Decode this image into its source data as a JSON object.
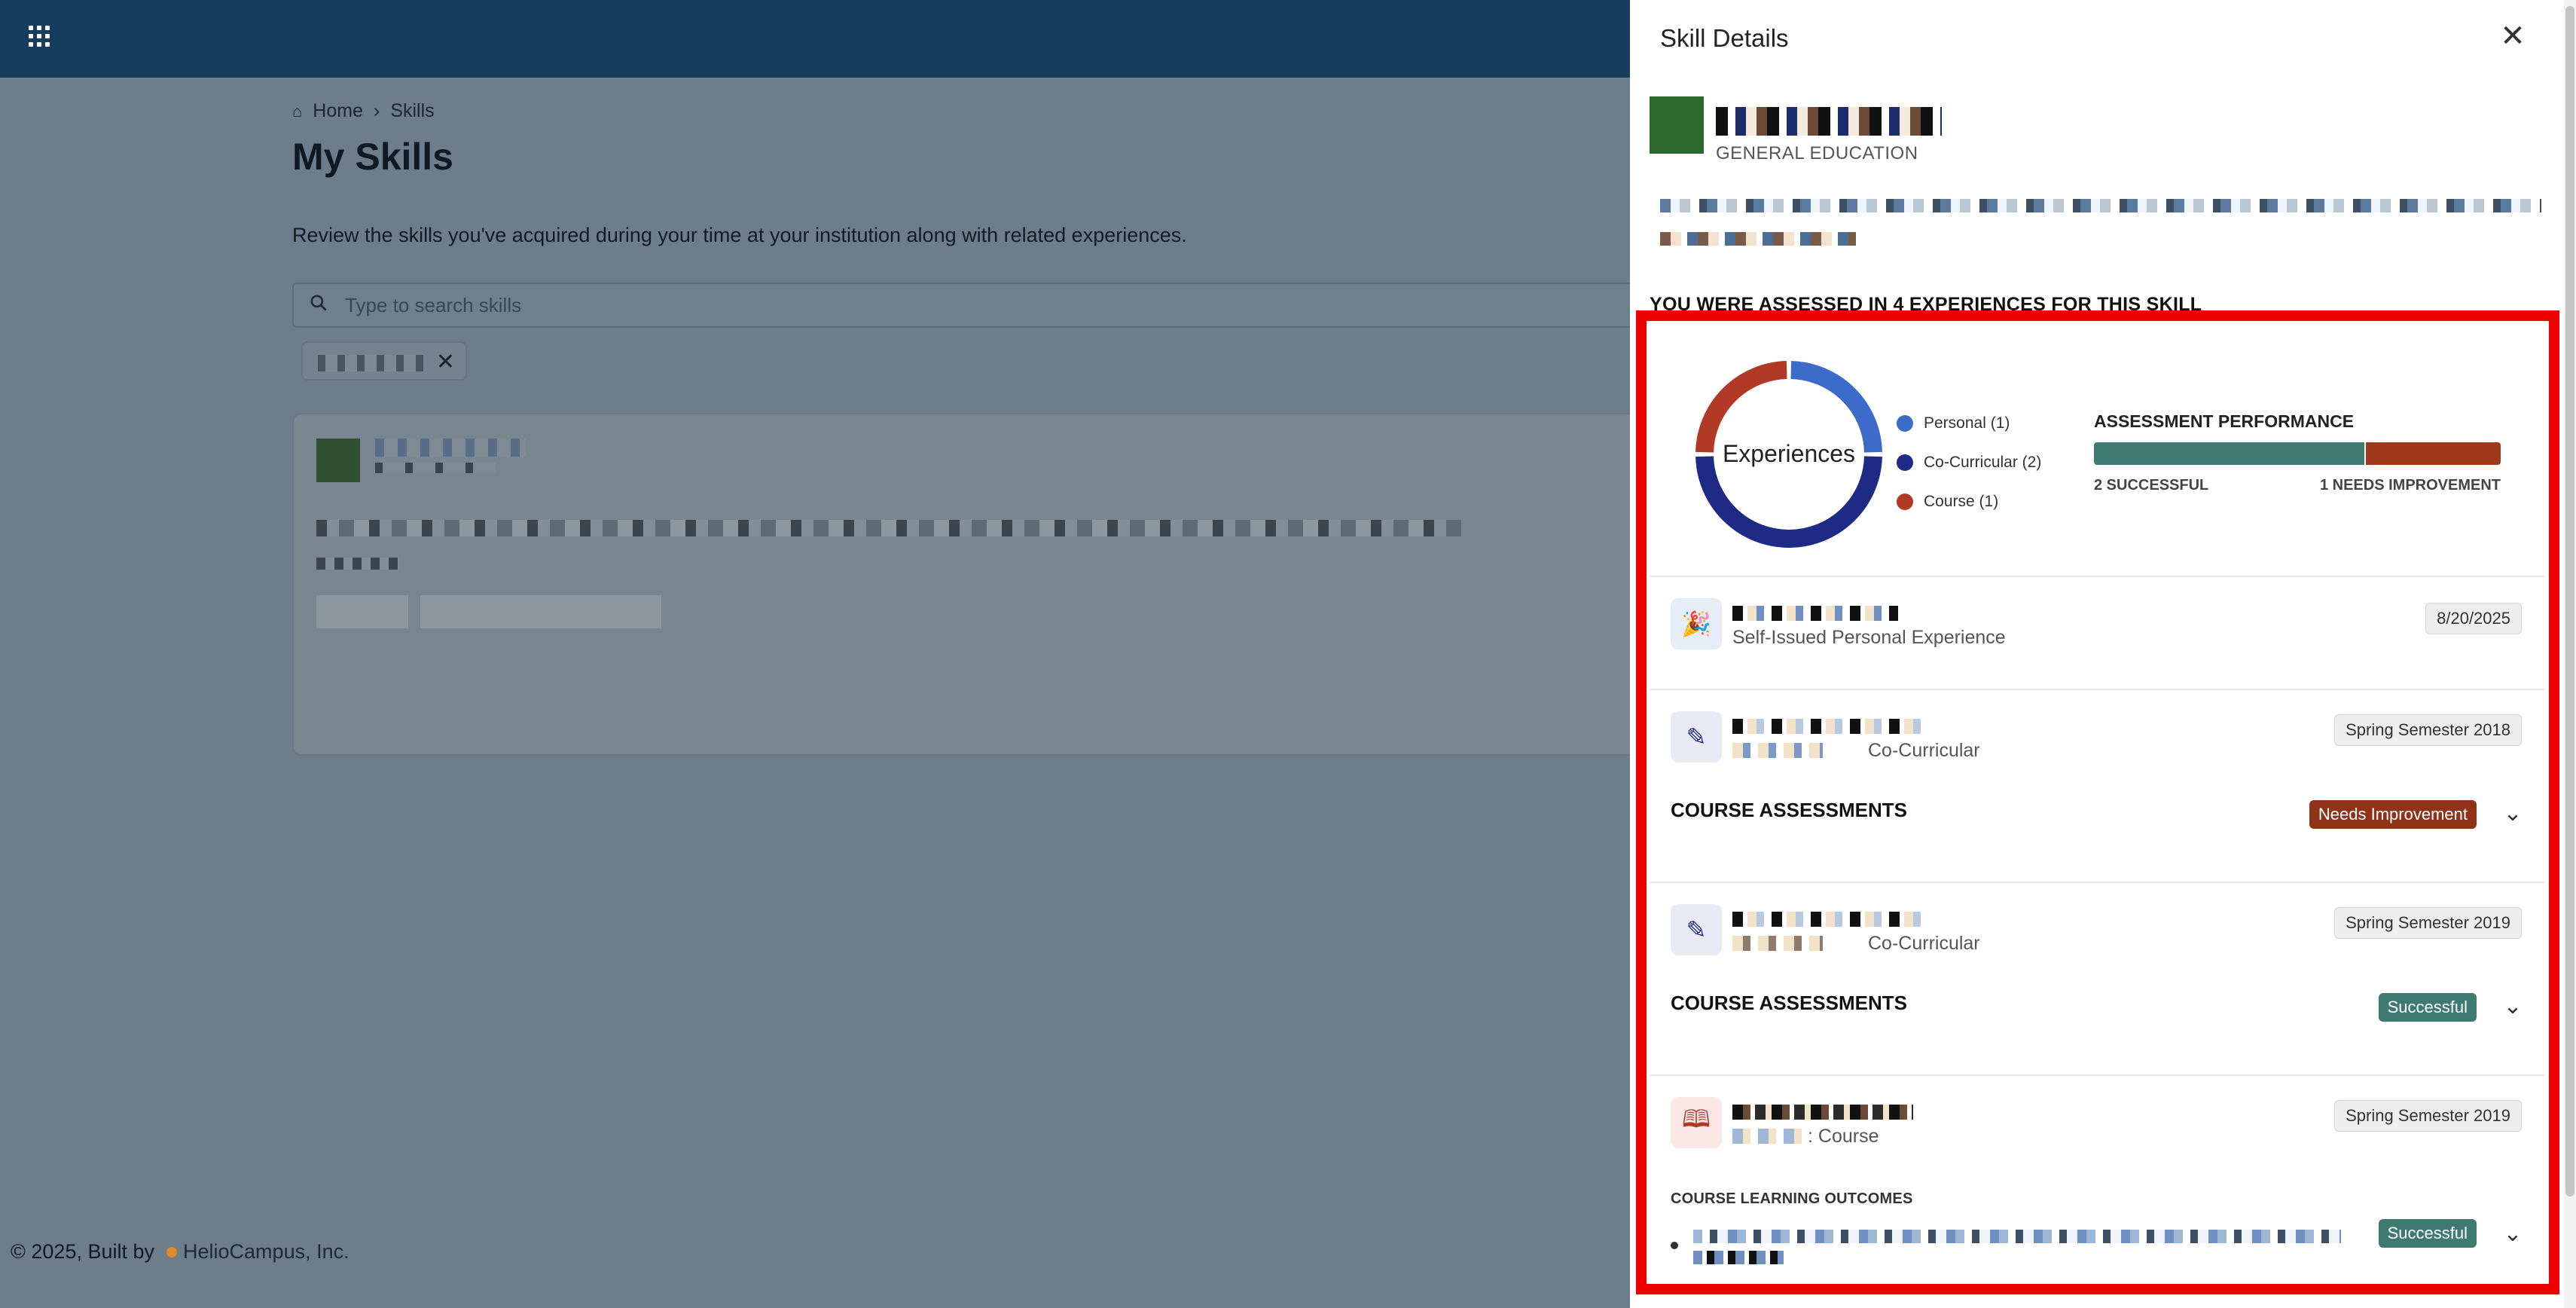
{
  "topbar": {
    "apps_icon": "grid-icon"
  },
  "breadcrumb": {
    "home": "Home",
    "separator": "›",
    "current": "Skills"
  },
  "page": {
    "title": "My Skills",
    "description": "Review the skills you've acquired during your time at your institution along with related experiences."
  },
  "search": {
    "placeholder": "Type to search skills",
    "value": ""
  },
  "filter_chip": {
    "remove": "✕"
  },
  "footer": {
    "copyright": "© 2025, Built by",
    "brand": "HelioCampus, Inc."
  },
  "panel": {
    "title": "Skill Details",
    "close": "✕",
    "skill_category": "GENERAL EDUCATION",
    "assessed_heading": "YOU WERE ASSESSED IN 4 EXPERIENCES FOR THIS SKILL",
    "donut_label": "Experiences",
    "legend": [
      {
        "label": "Personal (1)",
        "color": "#3d6bc9"
      },
      {
        "label": "Co-Curricular (2)",
        "color": "#1f2a85"
      },
      {
        "label": "Course (1)",
        "color": "#b13a26"
      }
    ],
    "performance": {
      "title": "ASSESSMENT PERFORMANCE",
      "successful_label": "2 SUCCESSFUL",
      "needs_label": "1 NEEDS IMPROVEMENT",
      "successful_count": 2,
      "needs_count": 1,
      "success_color": "#3e7a6f",
      "needs_color": "#a1391c"
    },
    "experiences": [
      {
        "type_label": "Self-Issued Personal Experience",
        "date": "8/20/2025",
        "icon": "party-popper-icon"
      },
      {
        "type_label": "Co-Curricular",
        "date": "Spring Semester 2018",
        "icon": "pen-icon",
        "section": "COURSE ASSESSMENTS",
        "status": "Needs Improvement"
      },
      {
        "type_label": "Co-Curricular",
        "date": "Spring Semester 2019",
        "icon": "pen-icon",
        "section": "COURSE ASSESSMENTS",
        "status": "Successful"
      },
      {
        "type_label": ": Course",
        "date": "Spring Semester 2019",
        "icon": "book-icon",
        "section": "COURSE LEARNING OUTCOMES",
        "status": "Successful"
      }
    ],
    "chevron": "⌄"
  }
}
